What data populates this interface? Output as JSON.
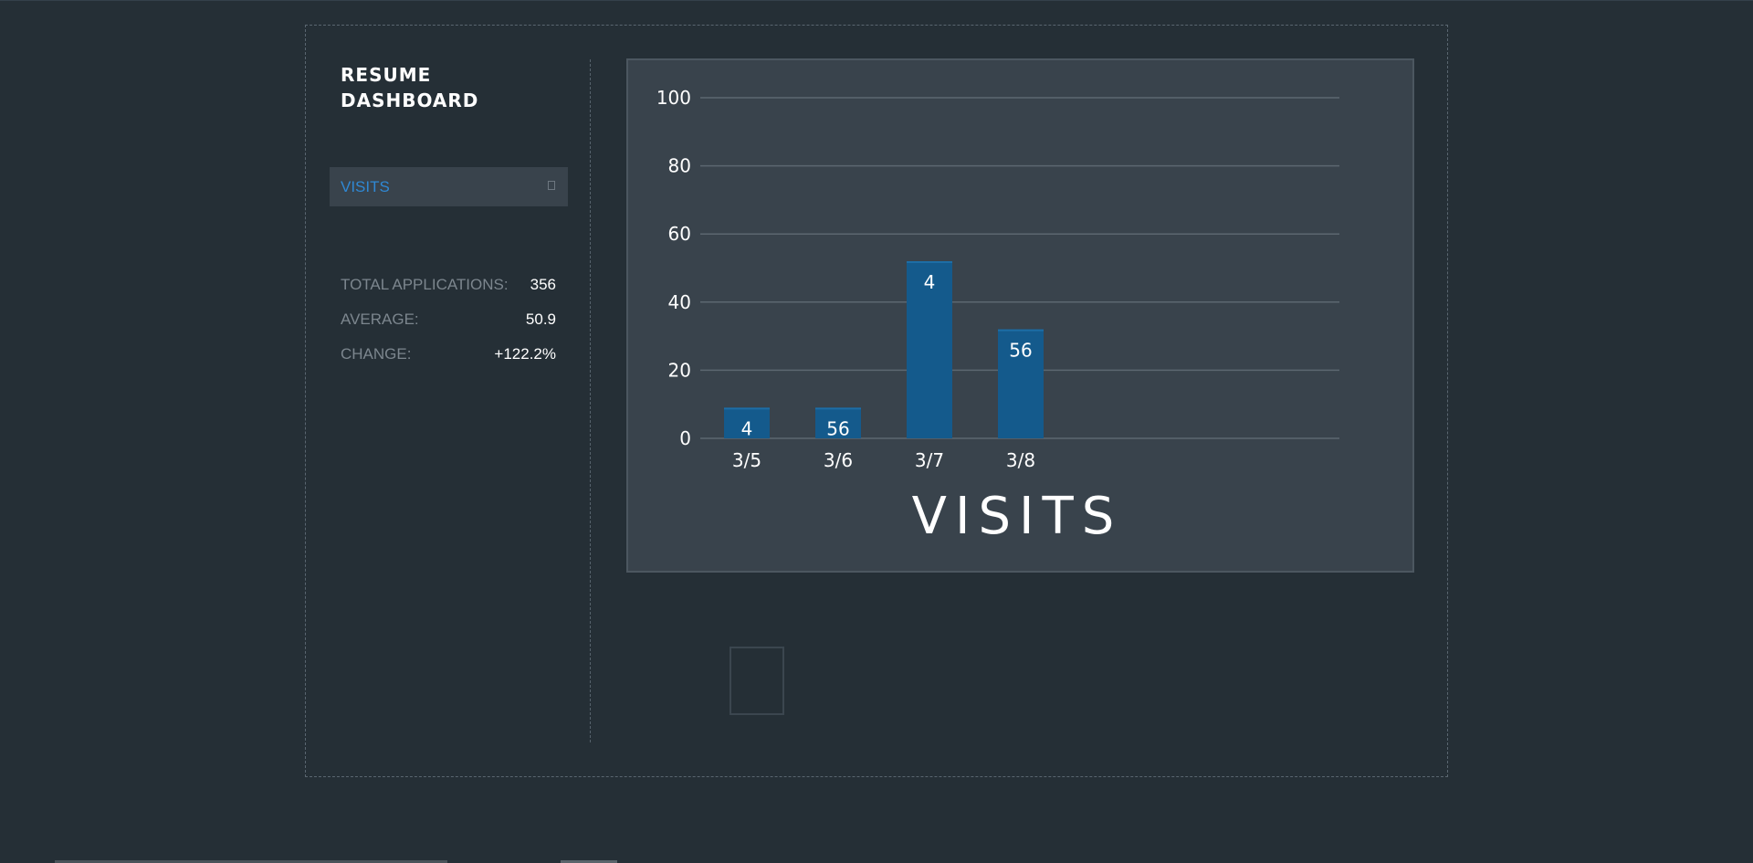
{
  "sidebar": {
    "title": "RESUME DASHBOARD",
    "nav": [
      {
        "label": "VISITS",
        "icon": "square-icon"
      }
    ],
    "stats": [
      {
        "label": "TOTAL APPLICATIONS:",
        "value": "356"
      },
      {
        "label": "AVERAGE:",
        "value": "50.9"
      },
      {
        "label": "CHANGE:",
        "value": "+122.2%"
      }
    ]
  },
  "colors": {
    "background": "#252f36",
    "panel": "#39434c",
    "accent": "#2f88d4",
    "bar": "#145a8c"
  },
  "chart_data": {
    "type": "bar",
    "title": "VISITS",
    "xlabel": "",
    "ylabel": "",
    "categories": [
      "3/5",
      "3/6",
      "3/7",
      "3/8"
    ],
    "values": [
      9,
      9,
      52,
      32
    ],
    "data_labels": [
      "4",
      "56",
      "4",
      "56"
    ],
    "ylim": [
      0,
      100
    ],
    "yticks": [
      0,
      20,
      40,
      60,
      80,
      100
    ],
    "grid": true,
    "legend": "none"
  }
}
